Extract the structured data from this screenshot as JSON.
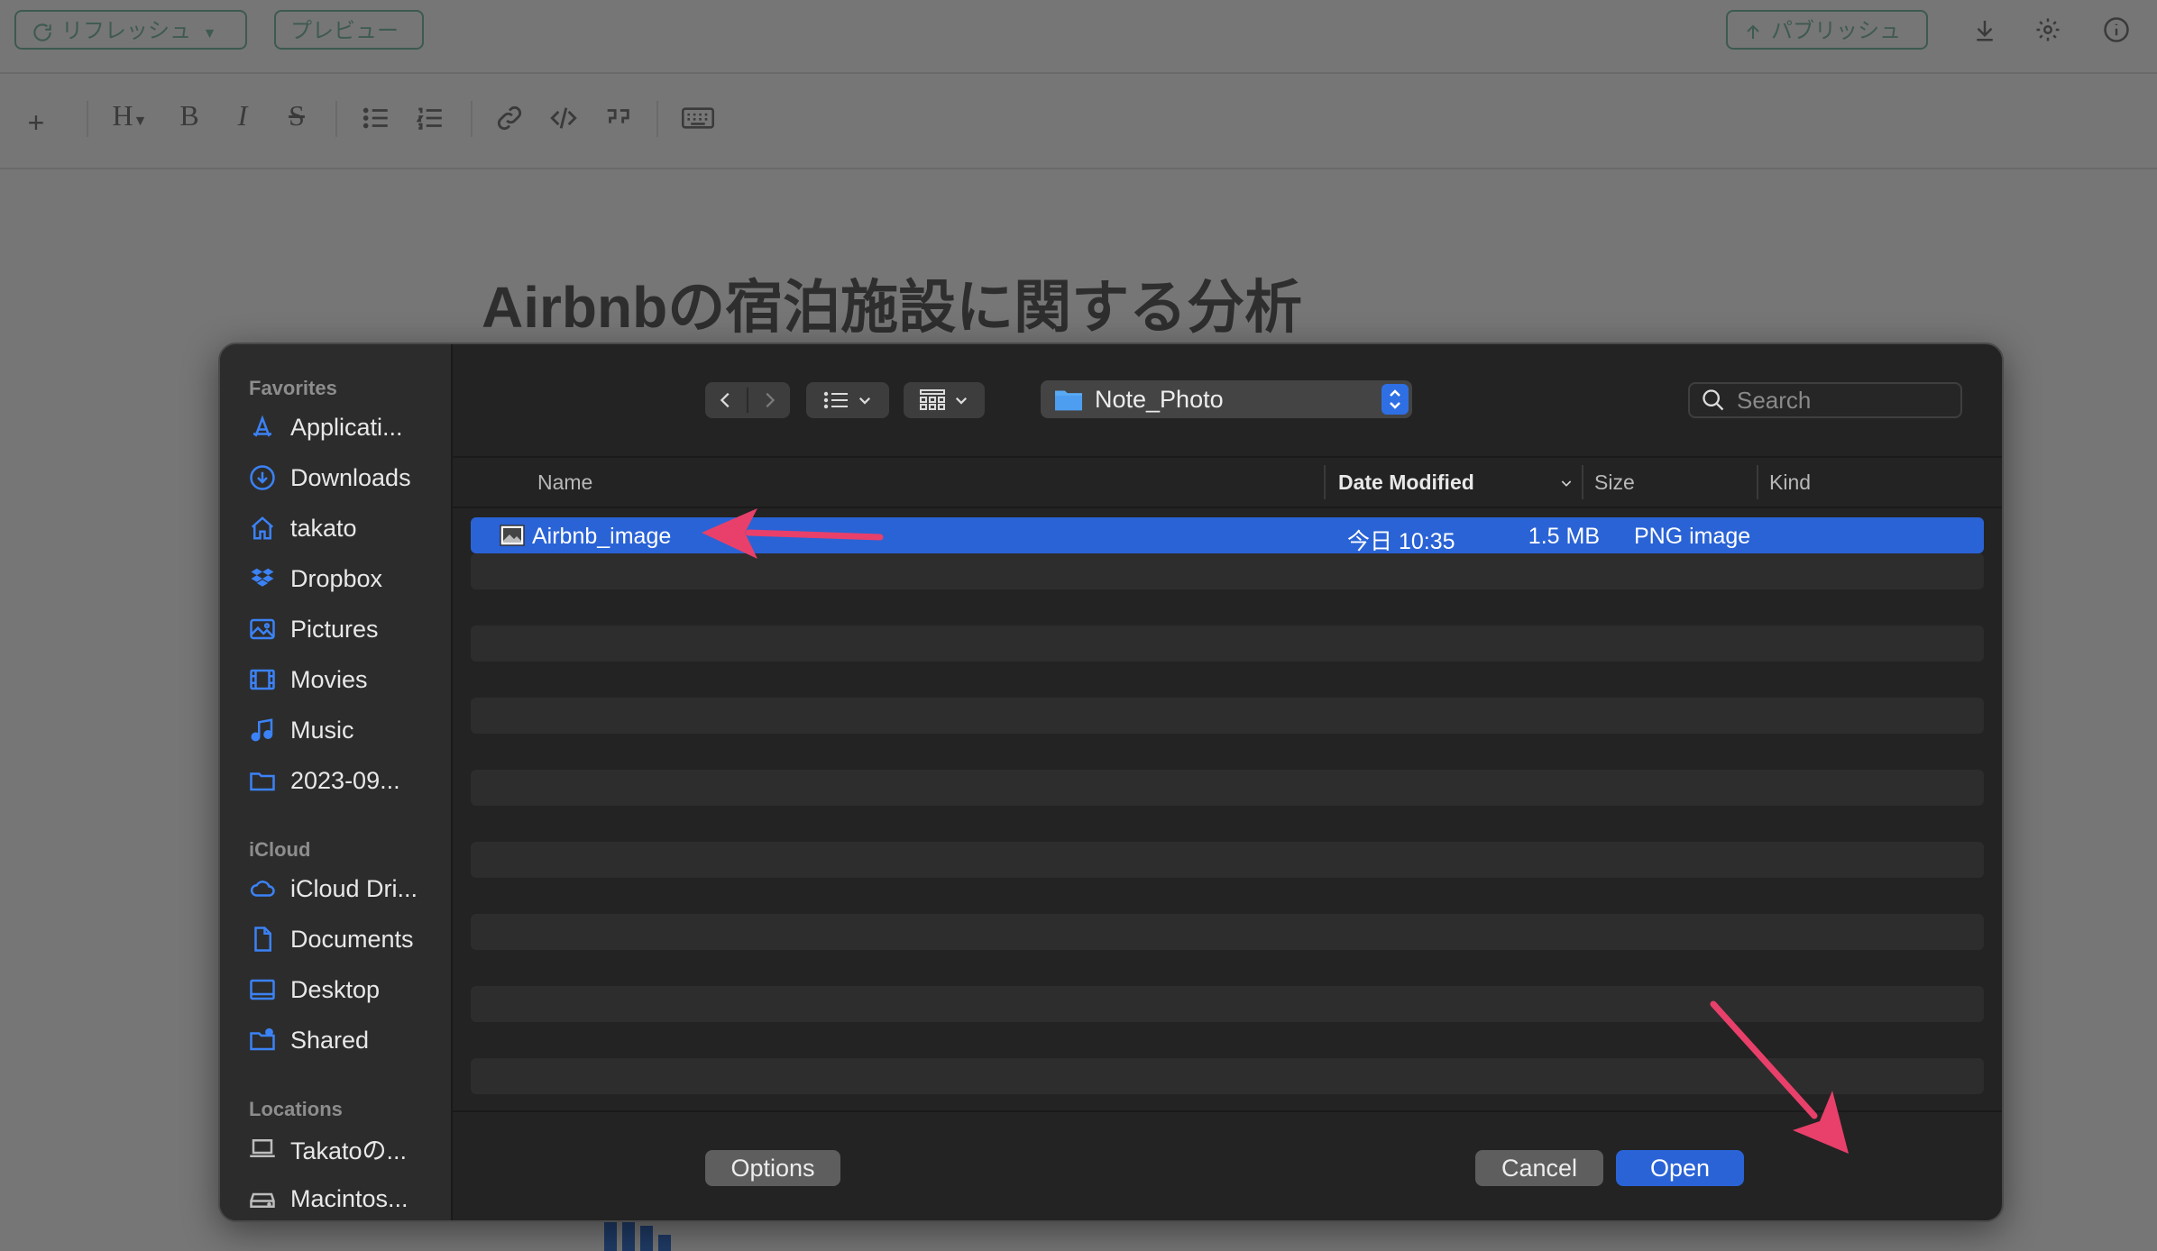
{
  "editor": {
    "refresh_label": "リフレッシュ",
    "preview_label": "プレビュー",
    "publish_label": "パブリッシュ",
    "heading_label": "H",
    "bold_label": "B",
    "italic_label": "I",
    "strike_label": "S",
    "document_title": "Airbnbの宿泊施設に関する分析"
  },
  "dialog": {
    "sidebar": {
      "favorites_header": "Favorites",
      "favorites": [
        {
          "label": "Applicati...",
          "icon": "applications-icon"
        },
        {
          "label": "Downloads",
          "icon": "downloads-icon"
        },
        {
          "label": "takato",
          "icon": "home-icon"
        },
        {
          "label": "Dropbox",
          "icon": "dropbox-icon"
        },
        {
          "label": "Pictures",
          "icon": "pictures-icon"
        },
        {
          "label": "Movies",
          "icon": "movies-icon"
        },
        {
          "label": "Music",
          "icon": "music-icon"
        },
        {
          "label": "2023-09...",
          "icon": "folder-icon"
        }
      ],
      "icloud_header": "iCloud",
      "icloud": [
        {
          "label": "iCloud Dri...",
          "icon": "cloud-icon"
        },
        {
          "label": "Documents",
          "icon": "document-icon"
        },
        {
          "label": "Desktop",
          "icon": "desktop-icon"
        },
        {
          "label": "Shared",
          "icon": "shared-folder-icon"
        }
      ],
      "locations_header": "Locations",
      "locations": [
        {
          "label": "Takatoの...",
          "icon": "laptop-icon"
        },
        {
          "label": "Macintos...",
          "icon": "disk-icon"
        }
      ]
    },
    "toolbar": {
      "current_folder": "Note_Photo",
      "search_placeholder": "Search"
    },
    "columns": {
      "name": "Name",
      "date_modified": "Date Modified",
      "size": "Size",
      "kind": "Kind"
    },
    "files": [
      {
        "name": "Airbnb_image",
        "date_modified": "今日 10:35",
        "size": "1.5 MB",
        "kind": "PNG image",
        "selected": true
      }
    ],
    "footer": {
      "options_label": "Options",
      "cancel_label": "Cancel",
      "open_label": "Open"
    }
  },
  "colors": {
    "selection": "#2a63d6",
    "annotation_arrow": "#e8406a",
    "accent_icon": "#3b82f6"
  }
}
